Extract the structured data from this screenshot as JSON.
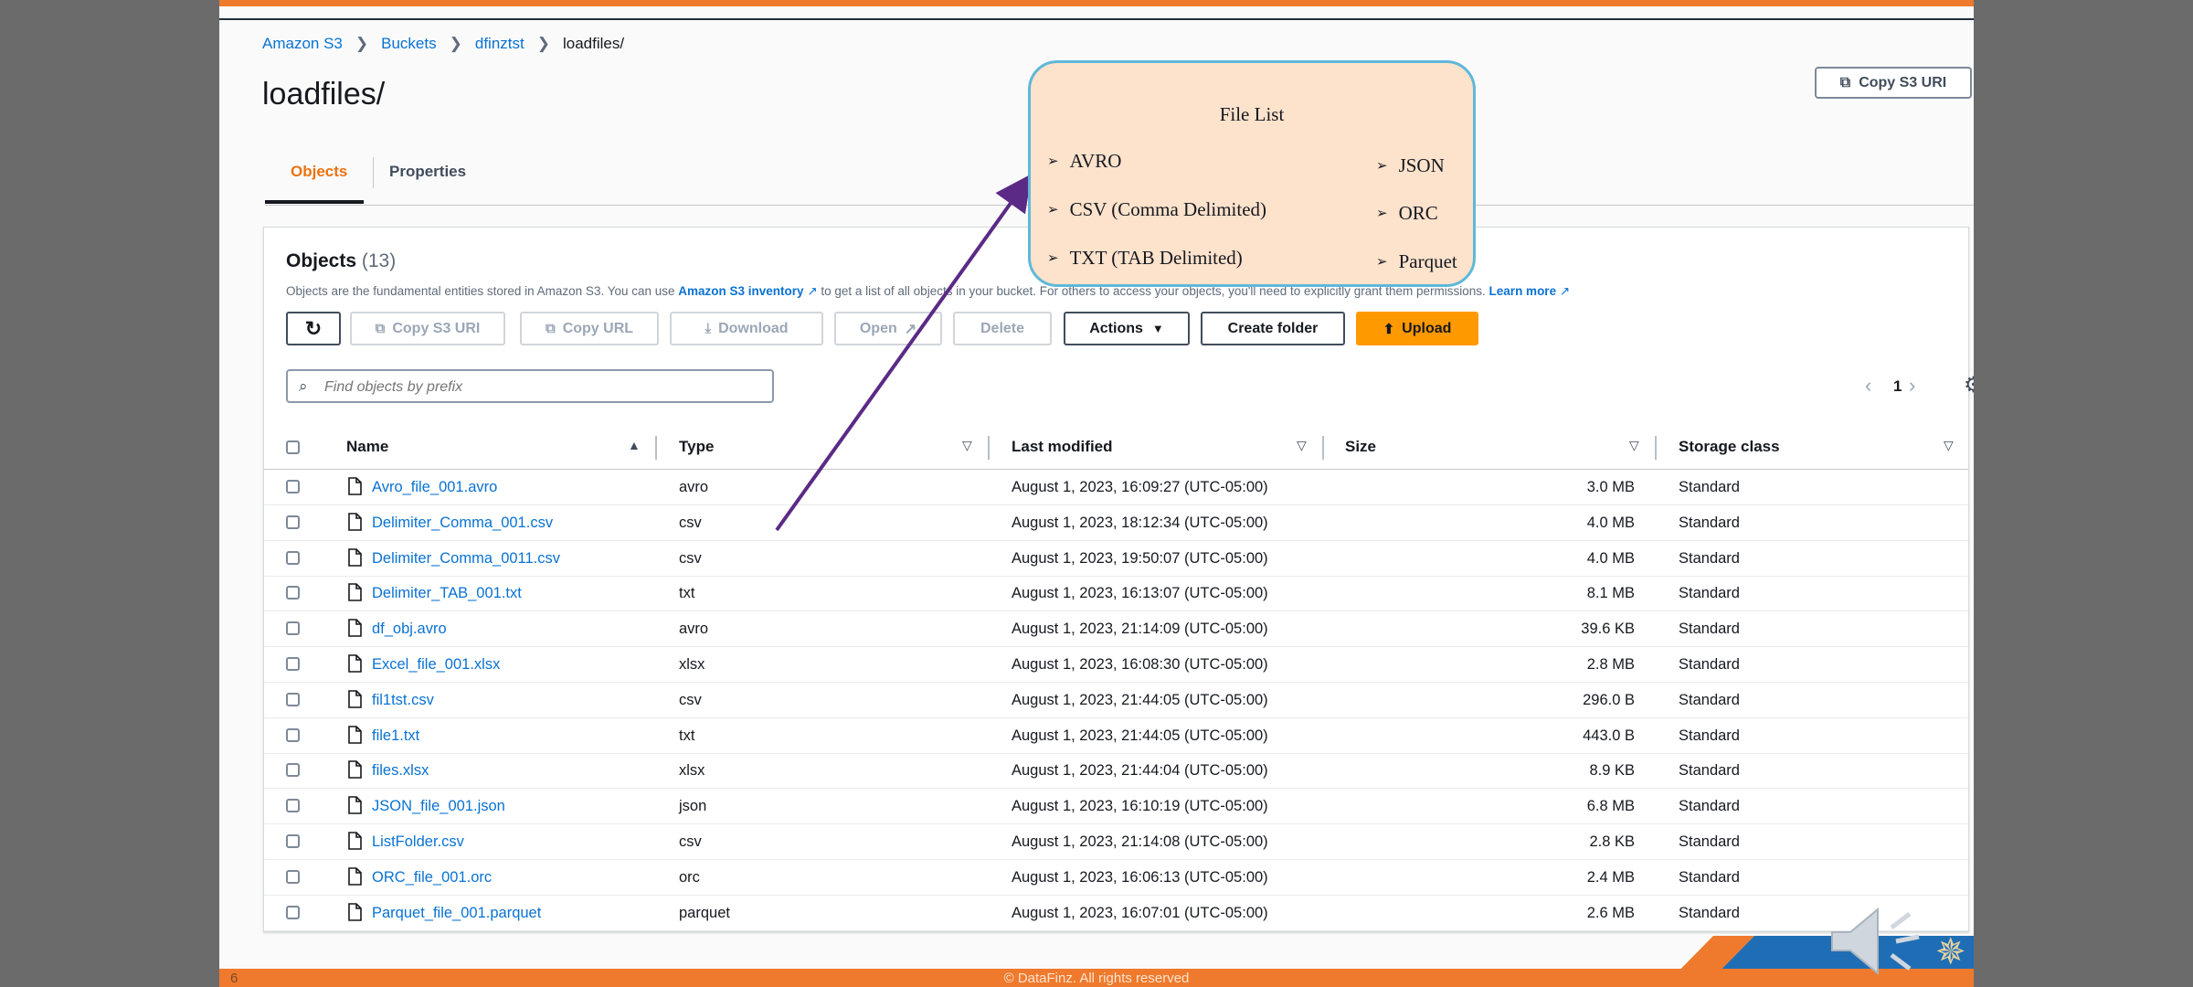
{
  "breadcrumb": [
    "Amazon S3",
    "Buckets",
    "dfinztst",
    "loadfiles/"
  ],
  "page_title": "loadfiles/",
  "copy_s3_uri_top": "Copy S3 URI",
  "tabs": [
    "Objects",
    "Properties"
  ],
  "objects": {
    "title": "Objects",
    "count": "(13)",
    "desc_1": "Objects are the fundamental entities stored in Amazon S3. You can use ",
    "desc_link": "Amazon S3 inventory",
    "desc_2": " to get a list of all objects in your bucket. For others to access your objects, you'll need to explicitly grant them permissions. ",
    "learn_more": "Learn more"
  },
  "toolbar": {
    "copy_s3_uri": "Copy S3 URI",
    "copy_url": "Copy URL",
    "download": "Download",
    "open": "Open",
    "delete": "Delete",
    "actions": "Actions",
    "create_folder": "Create folder",
    "upload": "Upload"
  },
  "search_placeholder": "Find objects by prefix",
  "pagination": {
    "page": "1"
  },
  "columns": [
    "Name",
    "Type",
    "Last modified",
    "Size",
    "Storage class"
  ],
  "rows": [
    {
      "name": "Avro_file_001.avro",
      "type": "avro",
      "modified": "August 1, 2023, 16:09:27 (UTC-05:00)",
      "size": "3.0 MB",
      "class": "Standard"
    },
    {
      "name": "Delimiter_Comma_001.csv",
      "type": "csv",
      "modified": "August 1, 2023, 18:12:34 (UTC-05:00)",
      "size": "4.0 MB",
      "class": "Standard"
    },
    {
      "name": "Delimiter_Comma_0011.csv",
      "type": "csv",
      "modified": "August 1, 2023, 19:50:07 (UTC-05:00)",
      "size": "4.0 MB",
      "class": "Standard"
    },
    {
      "name": "Delimiter_TAB_001.txt",
      "type": "txt",
      "modified": "August 1, 2023, 16:13:07 (UTC-05:00)",
      "size": "8.1 MB",
      "class": "Standard"
    },
    {
      "name": "df_obj.avro",
      "type": "avro",
      "modified": "August 1, 2023, 21:14:09 (UTC-05:00)",
      "size": "39.6 KB",
      "class": "Standard"
    },
    {
      "name": "Excel_file_001.xlsx",
      "type": "xlsx",
      "modified": "August 1, 2023, 16:08:30 (UTC-05:00)",
      "size": "2.8 MB",
      "class": "Standard"
    },
    {
      "name": "fil1tst.csv",
      "type": "csv",
      "modified": "August 1, 2023, 21:44:05 (UTC-05:00)",
      "size": "296.0 B",
      "class": "Standard"
    },
    {
      "name": "file1.txt",
      "type": "txt",
      "modified": "August 1, 2023, 21:44:05 (UTC-05:00)",
      "size": "443.0 B",
      "class": "Standard"
    },
    {
      "name": "files.xlsx",
      "type": "xlsx",
      "modified": "August 1, 2023, 21:44:04 (UTC-05:00)",
      "size": "8.9 KB",
      "class": "Standard"
    },
    {
      "name": "JSON_file_001.json",
      "type": "json",
      "modified": "August 1, 2023, 16:10:19 (UTC-05:00)",
      "size": "6.8 MB",
      "class": "Standard"
    },
    {
      "name": "ListFolder.csv",
      "type": "csv",
      "modified": "August 1, 2023, 21:14:08 (UTC-05:00)",
      "size": "2.8 KB",
      "class": "Standard"
    },
    {
      "name": "ORC_file_001.orc",
      "type": "orc",
      "modified": "August 1, 2023, 16:06:13 (UTC-05:00)",
      "size": "2.4 MB",
      "class": "Standard"
    },
    {
      "name": "Parquet_file_001.parquet",
      "type": "parquet",
      "modified": "August 1, 2023, 16:07:01 (UTC-05:00)",
      "size": "2.6 MB",
      "class": "Standard"
    }
  ],
  "callout": {
    "title": "File List",
    "left_items": [
      "AVRO",
      "CSV (Comma Delimited)",
      "TXT (TAB Delimited)"
    ],
    "right_items": [
      "JSON",
      "ORC",
      "Parquet"
    ]
  },
  "footer": {
    "page_number": "6",
    "copyright": "© DataFinz. All rights reserved"
  },
  "colors": {
    "accent": "#ec7211",
    "link": "#0972d3",
    "upload": "#ff9900",
    "slide_orange": "#ef7a2d",
    "callout_bg": "#fde2cc",
    "callout_border": "#5fb8d9",
    "arrow": "#5b2a86"
  }
}
